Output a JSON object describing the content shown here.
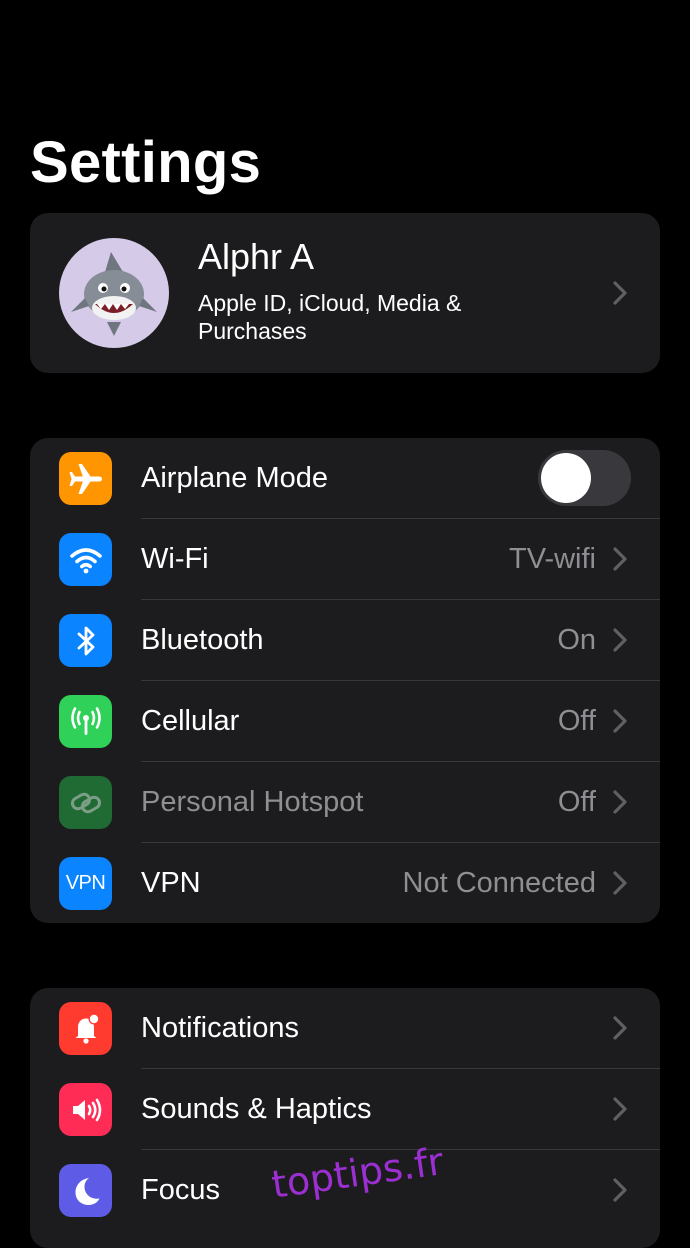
{
  "page": {
    "title": "Settings"
  },
  "profile": {
    "name": "Alphr A",
    "subtitle": "Apple ID, iCloud, Media & Purchases",
    "avatar_icon": "shark-memoji-avatar",
    "avatar_bg": "#d5cbe9"
  },
  "connectivity": [
    {
      "key": "airplane",
      "label": "Airplane Mode",
      "icon": "airplane-icon",
      "icon_bg": "#ff9500",
      "control": "toggle",
      "toggle_on": false
    },
    {
      "key": "wifi",
      "label": "Wi-Fi",
      "value": "TV-wifi",
      "icon": "wifi-icon",
      "icon_bg": "#0a84ff"
    },
    {
      "key": "bluetooth",
      "label": "Bluetooth",
      "value": "On",
      "icon": "bluetooth-icon",
      "icon_bg": "#0a84ff"
    },
    {
      "key": "cellular",
      "label": "Cellular",
      "value": "Off",
      "icon": "cellular-antenna-icon",
      "icon_bg": "#30d158"
    },
    {
      "key": "hotspot",
      "label": "Personal Hotspot",
      "value": "Off",
      "icon": "hotspot-link-icon",
      "icon_bg": "#1f6b33",
      "disabled": true
    },
    {
      "key": "vpn",
      "label": "VPN",
      "value": "Not Connected",
      "icon": "vpn-icon",
      "icon_text": "VPN",
      "icon_bg": "#0a84ff"
    }
  ],
  "system": [
    {
      "key": "notifications",
      "label": "Notifications",
      "icon": "notification-bell-icon",
      "icon_bg": "#ff3b30"
    },
    {
      "key": "sounds",
      "label": "Sounds & Haptics",
      "icon": "speaker-icon",
      "icon_bg": "#ff2d55"
    },
    {
      "key": "focus",
      "label": "Focus",
      "icon": "moon-icon",
      "icon_bg": "#5e5ce6"
    }
  ],
  "colors": {
    "background": "#000000",
    "group_bg": "#1c1c1e",
    "separator": "#38383a",
    "secondary_text": "#8e8e93",
    "watermark": "#9b2fd1"
  },
  "watermark": {
    "text": "toptips.fr"
  }
}
